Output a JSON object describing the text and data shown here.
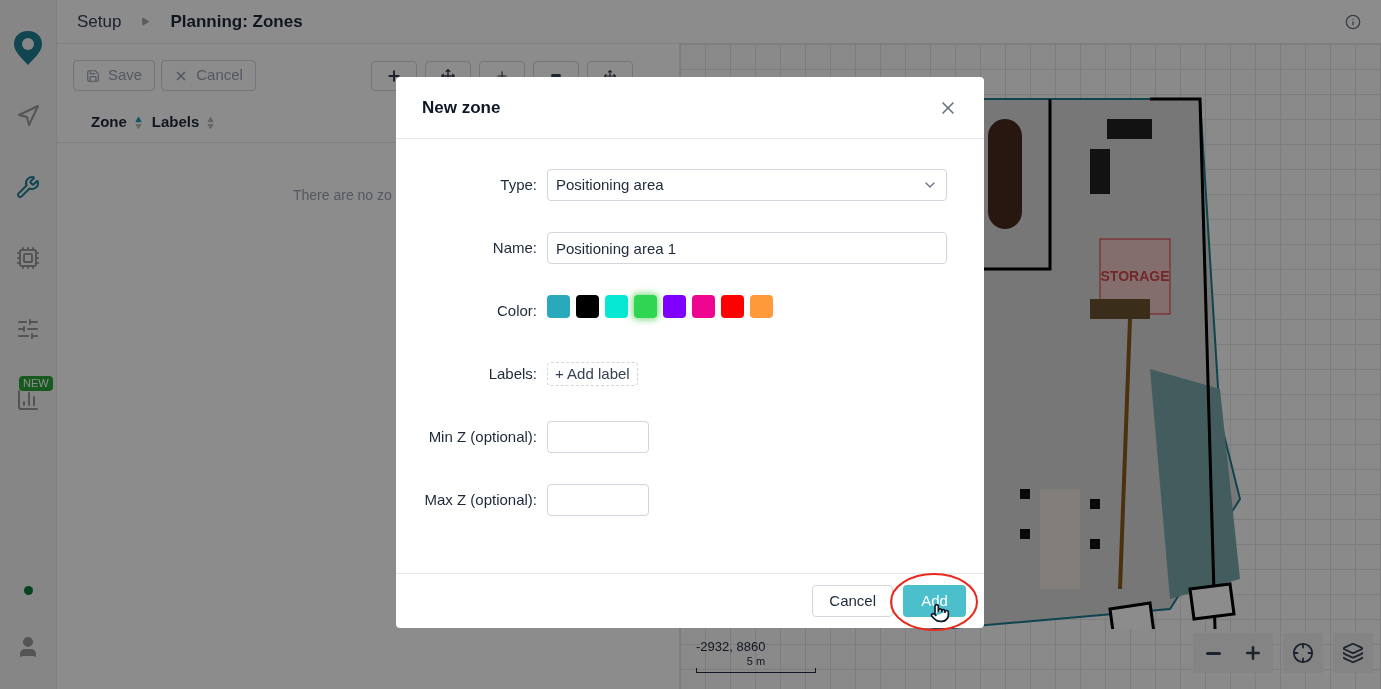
{
  "breadcrumb": {
    "root": "Setup",
    "current": "Planning: Zones"
  },
  "sidebar": {
    "items": [
      {
        "kind": "navigate",
        "selected": false
      },
      {
        "kind": "wrench",
        "selected": true
      },
      {
        "kind": "chip",
        "selected": false
      },
      {
        "kind": "sliders",
        "selected": false
      },
      {
        "kind": "chart",
        "selected": false,
        "badge": "NEW"
      }
    ],
    "online": true
  },
  "toolbar": {
    "save": "Save",
    "cancel": "Cancel"
  },
  "table": {
    "columns": [
      {
        "label": "Zone",
        "sorted": true
      },
      {
        "label": "Labels",
        "sorted": false
      }
    ],
    "empty_message": "There are no zo"
  },
  "map": {
    "room_label": "STORAGE",
    "coordinates": "-2932, 8860",
    "scale": "5 m"
  },
  "dialog": {
    "title": "New zone",
    "type": {
      "label": "Type:",
      "value": "Positioning area"
    },
    "name": {
      "label": "Name:",
      "value": "Positioning area 1"
    },
    "color": {
      "label": "Color:",
      "swatches": [
        {
          "color": "#2aa9bd",
          "selected": false
        },
        {
          "color": "#000000",
          "selected": false
        },
        {
          "color": "#07e8d4",
          "selected": false
        },
        {
          "color": "#2fd652",
          "selected": true
        },
        {
          "color": "#8000ff",
          "selected": false
        },
        {
          "color": "#ee0590",
          "selected": false
        },
        {
          "color": "#ff0000",
          "selected": false
        },
        {
          "color": "#ff9a3a",
          "selected": false
        }
      ]
    },
    "labels": {
      "label": "Labels:",
      "button": "+ Add label"
    },
    "min_z": {
      "label": "Min Z (optional):"
    },
    "max_z": {
      "label": "Max Z (optional):"
    },
    "buttons": {
      "cancel": "Cancel",
      "add": "Add"
    }
  }
}
